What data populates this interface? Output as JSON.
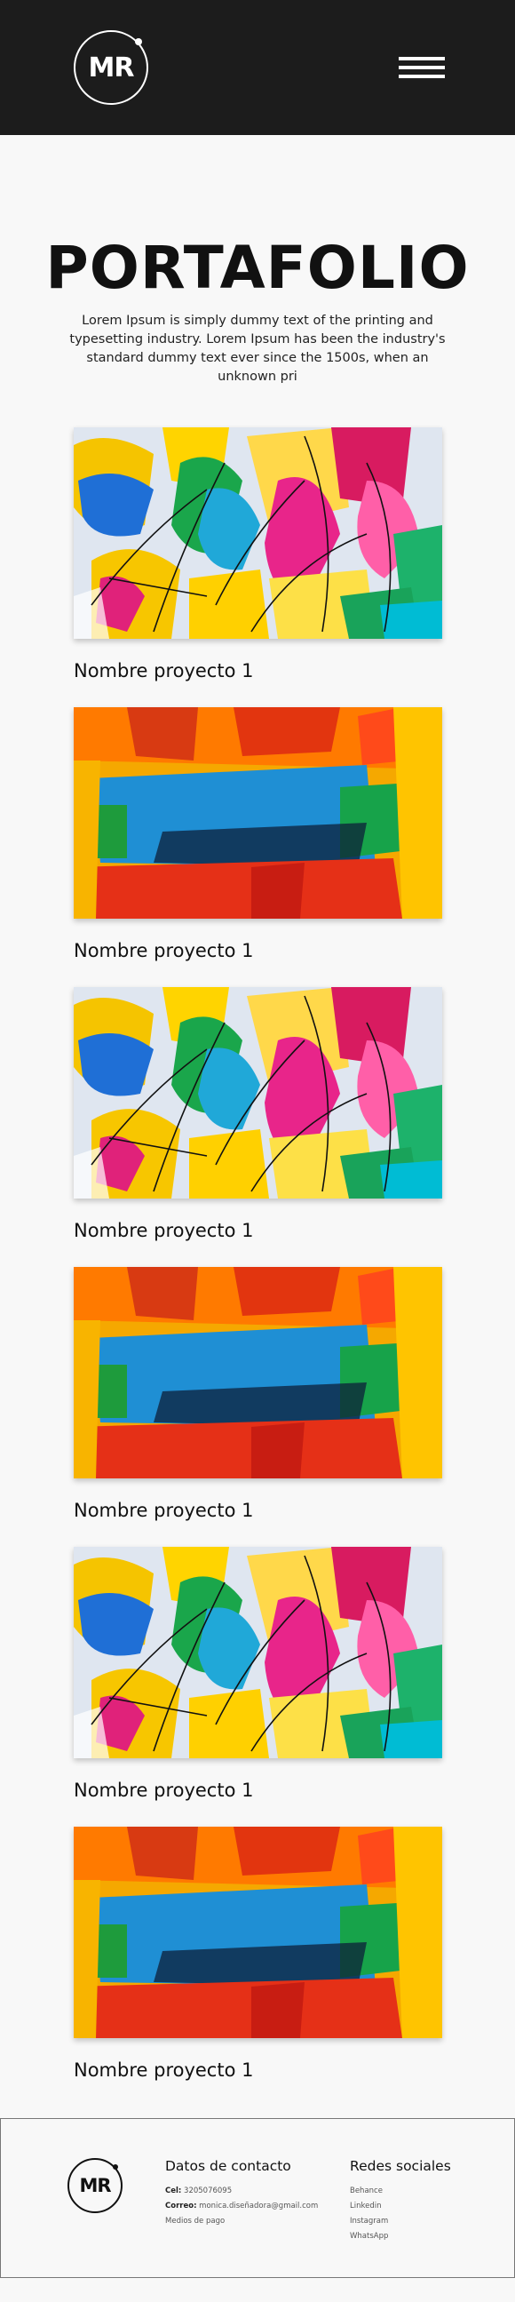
{
  "header": {
    "logo_text": "MR",
    "menu_icon": "hamburger-menu-icon"
  },
  "hero": {
    "title": "PORTAFOLIO",
    "description": "Lorem Ipsum is simply dummy text of the printing and typesetting industry. Lorem Ipsum has been the industry's standard dummy text ever since the 1500s, when an unknown pri"
  },
  "projects": [
    {
      "name": "Nombre proyecto 1",
      "image": "abstract-painting-light"
    },
    {
      "name": "Nombre proyecto 1",
      "image": "abstract-painting-warm"
    },
    {
      "name": "Nombre proyecto 1",
      "image": "abstract-painting-light"
    },
    {
      "name": "Nombre proyecto 1",
      "image": "abstract-painting-warm"
    },
    {
      "name": "Nombre proyecto 1",
      "image": "abstract-painting-light"
    },
    {
      "name": "Nombre proyecto 1",
      "image": "abstract-painting-warm"
    }
  ],
  "footer": {
    "logo_text": "MR",
    "contact": {
      "title": "Datos de contacto",
      "phone_label": "Cel:",
      "phone": "3205076095",
      "email_label": "Correo:",
      "email": "monica.diseñadora@gmail.com",
      "payment": "Medios de pago"
    },
    "social": {
      "title": "Redes sociales",
      "links": [
        "Behance",
        "Linkedin",
        "Instagram",
        "WhatsApp"
      ]
    }
  },
  "colors": {
    "header_bg": "#1c1c1c",
    "page_bg": "#f8f8f8",
    "text": "#111111"
  }
}
